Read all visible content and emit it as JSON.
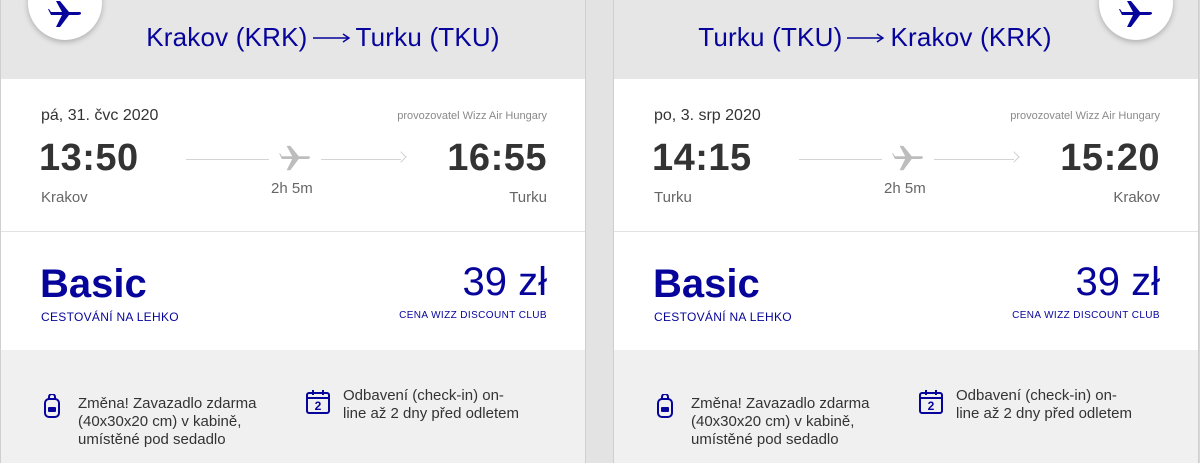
{
  "flights": [
    {
      "route": {
        "from": "Krakov (KRK)",
        "to": "Turku (TKU)"
      },
      "date": "pá, 31. čvc 2020",
      "operator": "provozovatel Wizz Air Hungary",
      "departure": {
        "time": "13:50",
        "city": "Krakov"
      },
      "arrival": {
        "time": "16:55",
        "city": "Turku"
      },
      "duration": "2h 5m",
      "fare": {
        "name": "Basic",
        "subtitle": "CESTOVÁNÍ NA LEHKO",
        "price": "39 zł",
        "price_note": "CENA WIZZ DISCOUNT CLUB"
      },
      "perks": {
        "baggage": [
          "Změna! Zavazadlo zdarma",
          "(40x30x20 cm) v kabině,",
          "umístěné pod sedadlo"
        ],
        "checkin": [
          "Odbavení (check-in) on-",
          "line až 2 dny před odletem"
        ],
        "checkin_icon_number": "2"
      }
    },
    {
      "route": {
        "from": "Turku (TKU)",
        "to": "Krakov (KRK)"
      },
      "date": "po, 3. srp 2020",
      "operator": "provozovatel Wizz Air Hungary",
      "departure": {
        "time": "14:15",
        "city": "Turku"
      },
      "arrival": {
        "time": "15:20",
        "city": "Krakov"
      },
      "duration": "2h 5m",
      "fare": {
        "name": "Basic",
        "subtitle": "CESTOVÁNÍ NA LEHKO",
        "price": "39 zł",
        "price_note": "CENA WIZZ DISCOUNT CLUB"
      },
      "perks": {
        "baggage": [
          "Změna! Zavazadlo zdarma",
          "(40x30x20 cm) v kabině,",
          "umístěné pod sedadlo"
        ],
        "checkin": [
          "Odbavení (check-in) on-",
          "line až 2 dny před odletem"
        ],
        "checkin_icon_number": "2"
      }
    }
  ],
  "icons": [
    "plane-icon",
    "route-arrow-icon",
    "backpack-icon",
    "calendar-icon"
  ],
  "colors": {
    "brand": "#06049a",
    "header_bg": "#e6e6e6",
    "perks_bg": "#f0f0f0"
  }
}
